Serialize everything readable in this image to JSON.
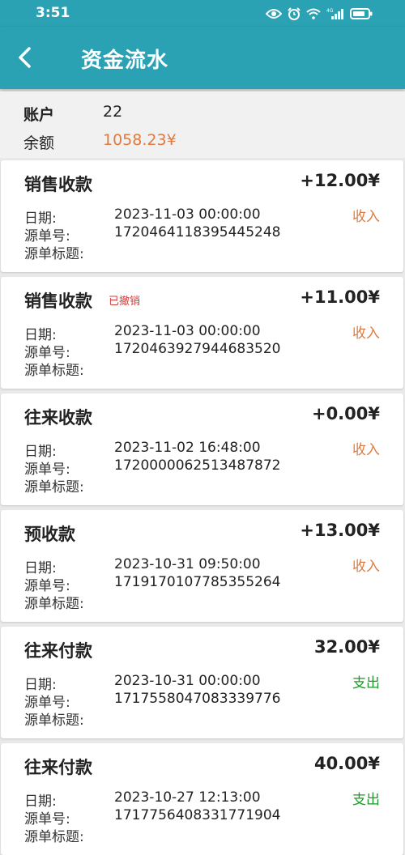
{
  "status_bar": {
    "time": "3:51",
    "icons": [
      "eye-icon",
      "alarm-icon",
      "wifi-icon",
      "signal-4g-icon",
      "battery-icon"
    ],
    "network": "4G"
  },
  "app_bar": {
    "title": "资金流水",
    "back_icon": "chevron-left-icon",
    "background": "#2aa2b3"
  },
  "account": {
    "account_label": "账户",
    "account_value": "22",
    "balance_label": "余额",
    "balance_value": "1058.23¥",
    "balance_color": "#e07a3e"
  },
  "field_labels": {
    "date": "日期:",
    "source_no": "源单号:",
    "source_title": "源单标题:"
  },
  "records": [
    {
      "type": "销售收款",
      "cancel_tag": "",
      "amount": "+12.00¥",
      "flow": "收入",
      "flow_kind": "income",
      "date": "2023-11-03 00:00:00",
      "source_no": "1720464118395445248",
      "source_title": ""
    },
    {
      "type": "销售收款",
      "cancel_tag": "已撤销",
      "amount": "+11.00¥",
      "flow": "收入",
      "flow_kind": "income",
      "date": "2023-11-03 00:00:00",
      "source_no": "1720463927944683520",
      "source_title": ""
    },
    {
      "type": "往来收款",
      "cancel_tag": "",
      "amount": "+0.00¥",
      "flow": "收入",
      "flow_kind": "income",
      "date": "2023-11-02 16:48:00",
      "source_no": "1720000062513487872",
      "source_title": ""
    },
    {
      "type": "预收款",
      "cancel_tag": "",
      "amount": "+13.00¥",
      "flow": "收入",
      "flow_kind": "income",
      "date": "2023-10-31 09:50:00",
      "source_no": "1719170107785355264",
      "source_title": ""
    },
    {
      "type": "往来付款",
      "cancel_tag": "",
      "amount": "32.00¥",
      "flow": "支出",
      "flow_kind": "expense",
      "date": "2023-10-31 00:00:00",
      "source_no": "1717558047083339776",
      "source_title": ""
    },
    {
      "type": "往来付款",
      "cancel_tag": "",
      "amount": "40.00¥",
      "flow": "支出",
      "flow_kind": "expense",
      "date": "2023-10-27 12:13:00",
      "source_no": "1717756408331771904",
      "source_title": ""
    }
  ],
  "colors": {
    "income": "#e07a3e",
    "expense": "#1a9a26",
    "cancel": "#d23b3b"
  }
}
